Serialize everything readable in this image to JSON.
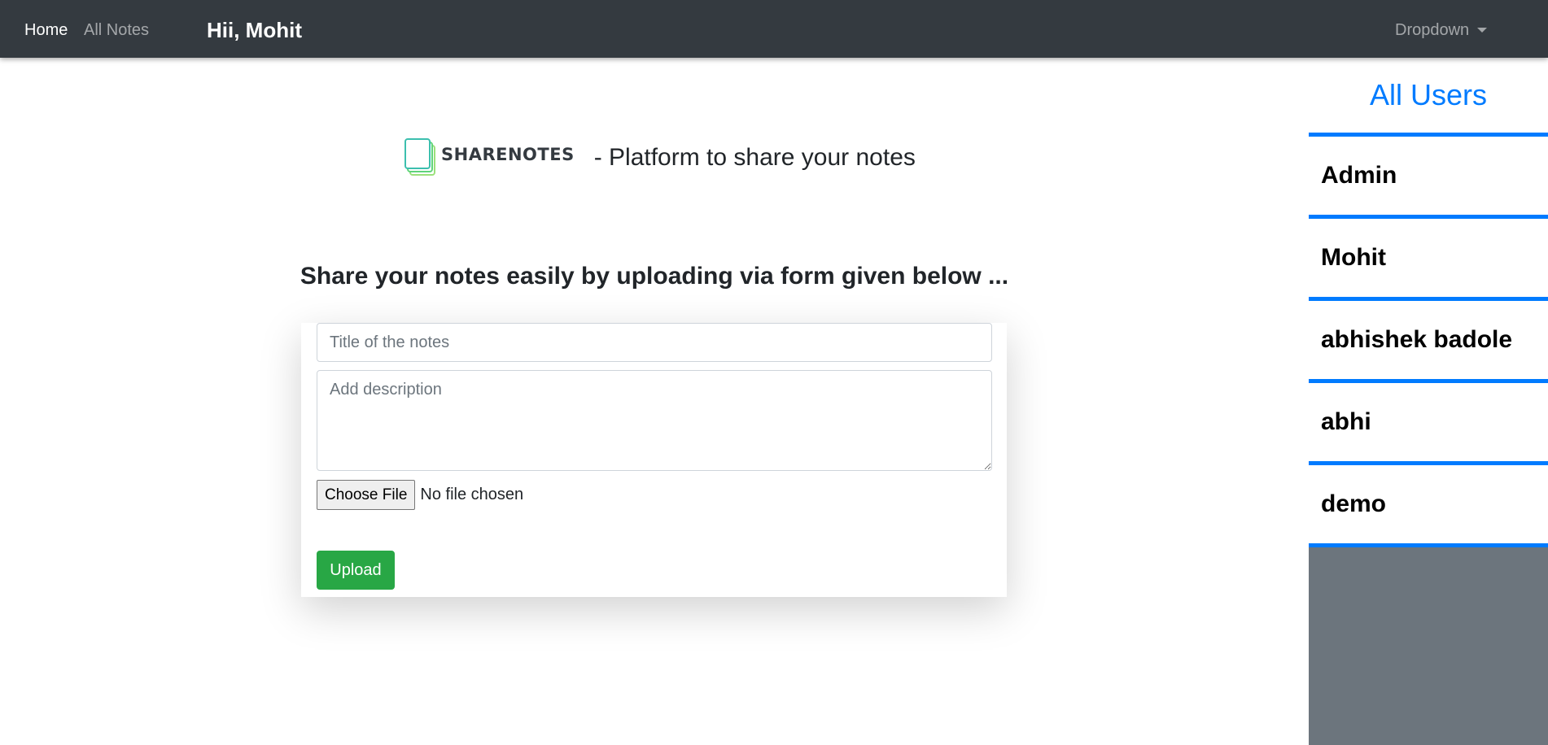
{
  "navbar": {
    "home_label": "Home",
    "all_notes_label": "All Notes",
    "greeting": "Hii, Mohit",
    "dropdown_label": "Dropdown"
  },
  "brand": {
    "logo_text": "SHARENOTES",
    "tagline": "- Platform to share your notes"
  },
  "main": {
    "heading": "Share your notes easily by uploading via form given below ..."
  },
  "form": {
    "title_placeholder": "Title of the notes",
    "description_placeholder": "Add description",
    "choose_file_label": "Choose File",
    "file_status": "No file chosen",
    "upload_label": "Upload"
  },
  "sidebar": {
    "title": "All Users",
    "items": [
      {
        "label": "Admin"
      },
      {
        "label": "Mohit"
      },
      {
        "label": "abhishek badole"
      },
      {
        "label": "abhi"
      },
      {
        "label": "demo"
      }
    ]
  },
  "colors": {
    "navbar_bg": "#343a40",
    "accent_blue": "#007bff",
    "upload_green": "#28a745",
    "sidebar_bg": "#6c757d",
    "logo_green": "#5fd47a"
  },
  "icons": {
    "logo": "stacked-notes-icon",
    "dropdown": "caret-down-icon"
  }
}
